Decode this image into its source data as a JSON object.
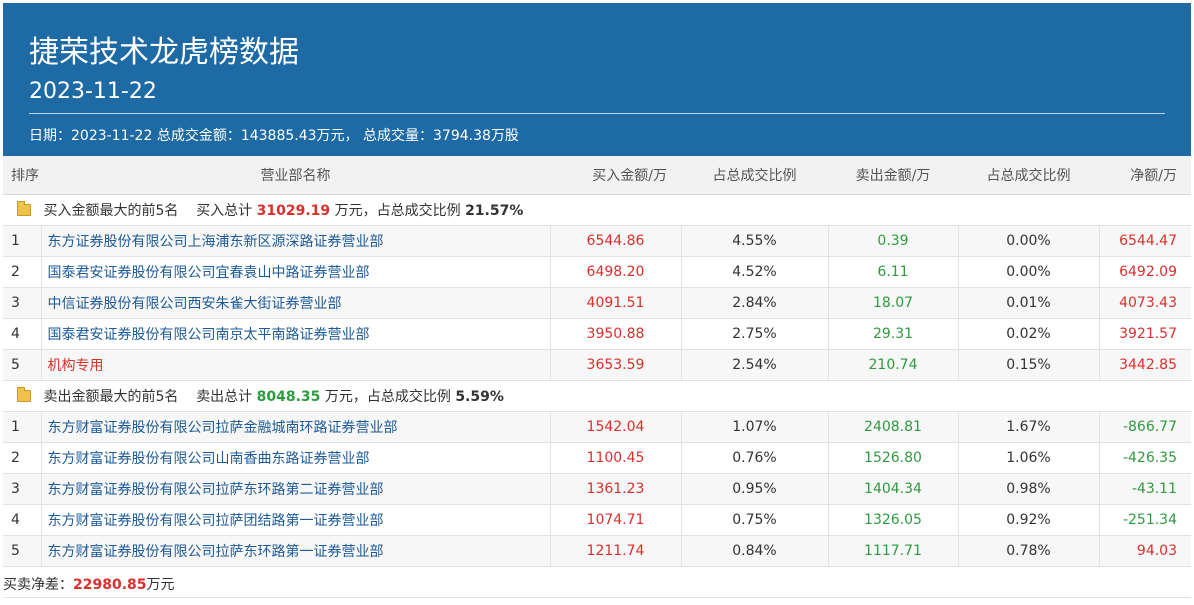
{
  "header": {
    "title": "捷荣技术龙虎榜数据",
    "date": "2023-11-22",
    "summary_date_label": "日期：",
    "summary_date": "2023-11-22",
    "summary_amount_label": "总成交金额：",
    "summary_amount": "143885.43万元，",
    "summary_volume_label": "总成交量：",
    "summary_volume": "3794.38万股"
  },
  "columns": [
    "排序",
    "营业部名称",
    "买入金额/万",
    "占总成交比例",
    "卖出金额/万",
    "占总成交比例",
    "净额/万"
  ],
  "buy_group": {
    "label": "买入金额最大的前5名",
    "total_label": "买入总计",
    "total": "31029.19",
    "unit_text": "万元，占总成交比例",
    "ratio": "21.57%",
    "rows": [
      {
        "rank": "1",
        "name": "东方证券股份有限公司上海浦东新区源深路证券营业部",
        "buy": "6544.86",
        "buy_pct": "4.55%",
        "sell": "0.39",
        "sell_pct": "0.00%",
        "net": "6544.47"
      },
      {
        "rank": "2",
        "name": "国泰君安证券股份有限公司宜春袁山中路证券营业部",
        "buy": "6498.20",
        "buy_pct": "4.52%",
        "sell": "6.11",
        "sell_pct": "0.00%",
        "net": "6492.09"
      },
      {
        "rank": "3",
        "name": "中信证券股份有限公司西安朱雀大街证券营业部",
        "buy": "4091.51",
        "buy_pct": "2.84%",
        "sell": "18.07",
        "sell_pct": "0.01%",
        "net": "4073.43"
      },
      {
        "rank": "4",
        "name": "国泰君安证券股份有限公司南京太平南路证券营业部",
        "buy": "3950.88",
        "buy_pct": "2.75%",
        "sell": "29.31",
        "sell_pct": "0.02%",
        "net": "3921.57"
      },
      {
        "rank": "5",
        "name": "机构专用",
        "buy": "3653.59",
        "buy_pct": "2.54%",
        "sell": "210.74",
        "sell_pct": "0.15%",
        "net": "3442.85"
      }
    ]
  },
  "sell_group": {
    "label": "卖出金额最大的前5名",
    "total_label": "卖出总计",
    "total": "8048.35",
    "unit_text": "万元，占总成交比例",
    "ratio": "5.59%",
    "rows": [
      {
        "rank": "1",
        "name": "东方财富证券股份有限公司拉萨金融城南环路证券营业部",
        "buy": "1542.04",
        "buy_pct": "1.07%",
        "sell": "2408.81",
        "sell_pct": "1.67%",
        "net": "-866.77"
      },
      {
        "rank": "2",
        "name": "东方财富证券股份有限公司山南香曲东路证券营业部",
        "buy": "1100.45",
        "buy_pct": "0.76%",
        "sell": "1526.80",
        "sell_pct": "1.06%",
        "net": "-426.35"
      },
      {
        "rank": "3",
        "name": "东方财富证券股份有限公司拉萨东环路第二证券营业部",
        "buy": "1361.23",
        "buy_pct": "0.95%",
        "sell": "1404.34",
        "sell_pct": "0.98%",
        "net": "-43.11"
      },
      {
        "rank": "4",
        "name": "东方财富证券股份有限公司拉萨团结路第一证券营业部",
        "buy": "1074.71",
        "buy_pct": "0.75%",
        "sell": "1326.05",
        "sell_pct": "0.92%",
        "net": "-251.34"
      },
      {
        "rank": "5",
        "name": "东方财富证券股份有限公司拉萨东环路第一证券营业部",
        "buy": "1211.74",
        "buy_pct": "0.84%",
        "sell": "1117.71",
        "sell_pct": "0.78%",
        "net": "94.03"
      }
    ]
  },
  "footer": {
    "label": "买卖净差：",
    "value": "22980.85",
    "unit": "万元"
  },
  "colors": {
    "header_bg": "#1d6aa5",
    "up_red": "#d9302c",
    "down_green": "#2f9a3f",
    "link_blue": "#1d5a96"
  }
}
